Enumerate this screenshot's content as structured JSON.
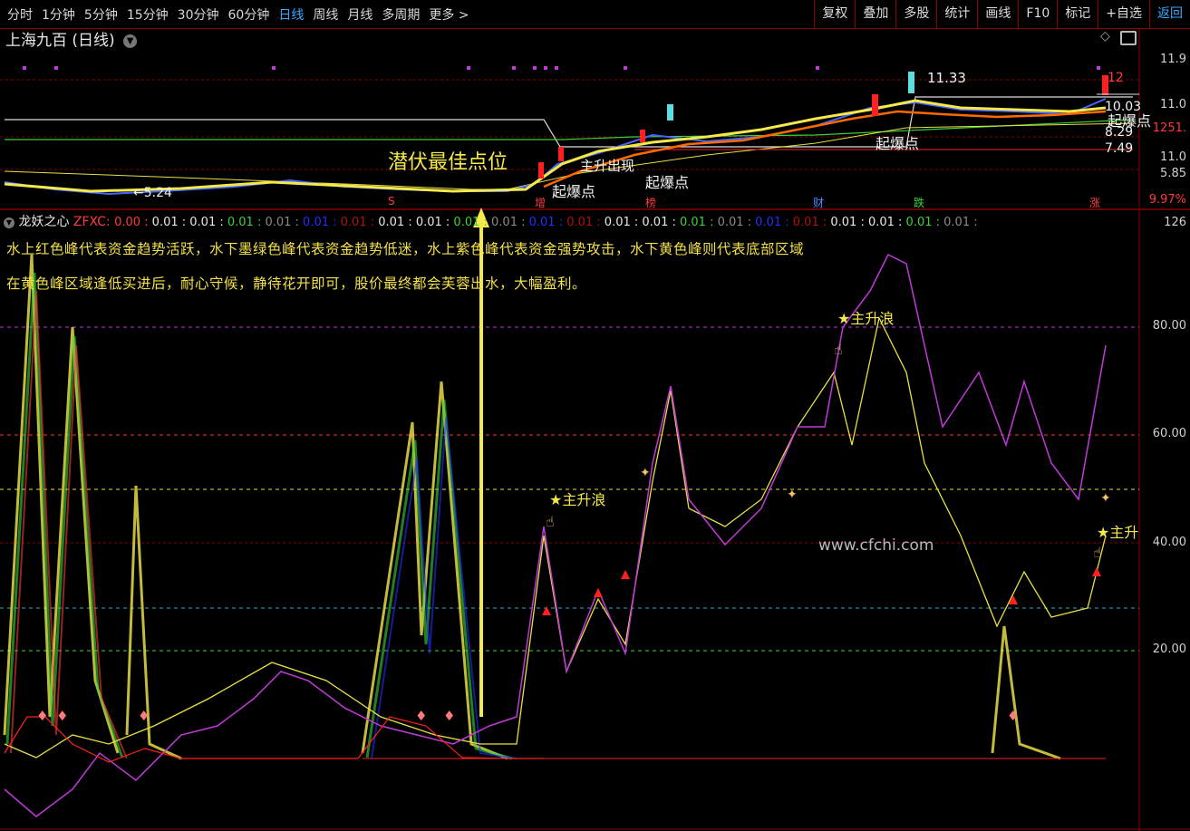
{
  "toolbar": {
    "periods": [
      "分时",
      "1分钟",
      "5分钟",
      "15分钟",
      "30分钟",
      "60分钟",
      "日线",
      "周线",
      "月线",
      "多周期",
      "更多 >"
    ],
    "active_period": "日线",
    "actions": [
      "复权",
      "叠加",
      "多股",
      "统计",
      "画线",
      "F10",
      "标记",
      "+自选",
      "返回"
    ]
  },
  "stock": {
    "title": "上海九百 (日线)"
  },
  "kline": {
    "price_high_label": "11.33",
    "price_low_label": "←5.24",
    "right_labels": [
      "12",
      "10.03",
      "8.29",
      "7.49"
    ],
    "yaxis": [
      "11.9",
      "11.0",
      "1251.",
      "11.0",
      "5.85"
    ],
    "pct_label": "9.97%",
    "event_tags": [
      {
        "text": "S",
        "color": "#ff3b3b"
      },
      {
        "text": "增",
        "color": "#ff3b3b"
      },
      {
        "text": "榜",
        "color": "#ff3b3b"
      },
      {
        "text": "财",
        "color": "#4a8cff"
      },
      {
        "text": "跌",
        "color": "#3ad33a"
      },
      {
        "text": "涨",
        "color": "#ff3b3b"
      }
    ],
    "annotations": [
      "潜伏最佳点位",
      "起爆点",
      "起爆点",
      "起爆点",
      "起爆点",
      "主升出现"
    ]
  },
  "indicator": {
    "name": "龙妖之心",
    "code": "ZFXC:",
    "values": [
      {
        "text": "0.00",
        "color": "#ff3b3b"
      },
      {
        "text": "0.01",
        "color": "#e8e8e8"
      },
      {
        "text": "0.01",
        "color": "#e8e8e8"
      },
      {
        "text": "0.01",
        "color": "#3ad33a"
      },
      {
        "text": "0.01",
        "color": "#8a8a8a"
      },
      {
        "text": "0.01",
        "color": "#2030ff"
      },
      {
        "text": "0.01",
        "color": "#b01010"
      },
      {
        "text": "0.01",
        "color": "#e8e8e8"
      },
      {
        "text": "0.01",
        "color": "#e8e8e8"
      },
      {
        "text": "0.01",
        "color": "#3ad33a"
      },
      {
        "text": "0.01",
        "color": "#8a8a8a"
      },
      {
        "text": "0.01",
        "color": "#2030ff"
      },
      {
        "text": "0.01",
        "color": "#b01010"
      },
      {
        "text": "0.01",
        "color": "#e8e8e8"
      },
      {
        "text": "0.01",
        "color": "#e8e8e8"
      },
      {
        "text": "0.01",
        "color": "#3ad33a"
      },
      {
        "text": "0.01",
        "color": "#8a8a8a"
      },
      {
        "text": "0.01",
        "color": "#2030ff"
      },
      {
        "text": "0.01",
        "color": "#b01010"
      },
      {
        "text": "0.01",
        "color": "#e8e8e8"
      },
      {
        "text": "0.01",
        "color": "#e8e8e8"
      },
      {
        "text": "0.01",
        "color": "#3ad33a"
      },
      {
        "text": "0.01",
        "color": "#8a8a8a"
      }
    ],
    "desc_line1": "水上红色峰代表资金趋势活跃，水下墨绿色峰代表资金趋势低迷，水上紫色峰代表资金强势攻击，水下黄色峰则代表底部区域",
    "desc_line2": "在黄色峰区域逢低买进后，耐心守候，静待花开即可，股价最终都会芙蓉出水，大幅盈利。",
    "yaxis": [
      "126",
      "80.00",
      "60.00",
      "40.00",
      "20.00"
    ],
    "labels": {
      "main_wave": "主升浪",
      "main_wave_cut": "主升"
    },
    "watermark": "www.cfchi.com"
  },
  "colors": {
    "accent": "#3aa8ff",
    "grid_red": "#8a0000",
    "yellow": "#f5e84a",
    "magenta": "#c03ad8",
    "red": "#ff2020"
  }
}
